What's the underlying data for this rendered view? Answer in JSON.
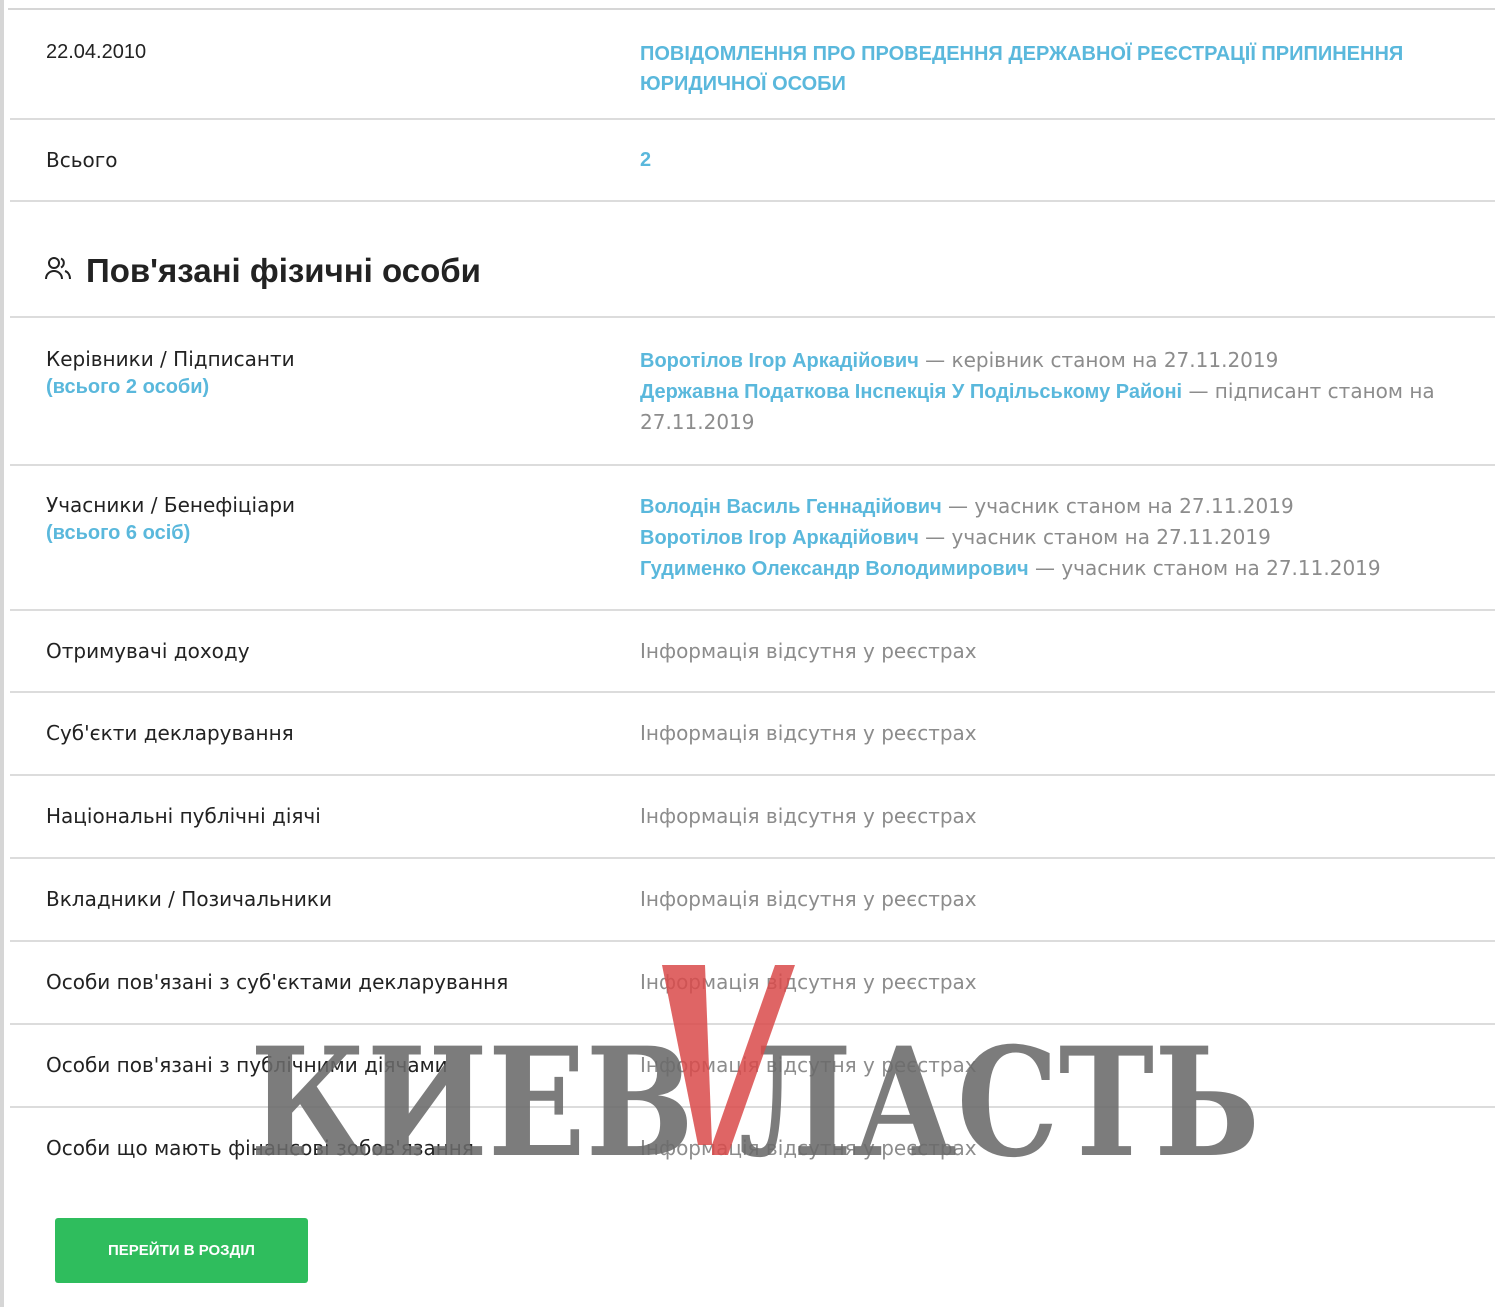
{
  "registrations": {
    "date": "22.04.2010",
    "notice": "ПОВІДОМЛЕННЯ ПРО ПРОВЕДЕННЯ ДЕРЖАВНОЇ РЕЄСТРАЦІЇ ПРИПИНЕННЯ ЮРИДИЧНОЇ ОСОБИ",
    "total_label": "Всього",
    "total_value": "2"
  },
  "section": {
    "icon": "people-icon",
    "title": "Пов'язані фізичні особи"
  },
  "managers": {
    "label": "Керівники / Підписанти",
    "count": "(всього 2 особи)",
    "items": [
      {
        "name": "Воротілов Ігор Аркадійович",
        "role": " — керівник станом на 27.11.2019"
      },
      {
        "name": "Державна Податкова Інспекція У Подільському Районі",
        "role": " — підписант станом на 27.11.2019"
      }
    ]
  },
  "participants": {
    "label": "Учасники / Бенефіціари",
    "count": "(всього 6 осіб)",
    "items": [
      {
        "name": "Володін Василь Геннадійович",
        "role": " — учасник станом на 27.11.2019"
      },
      {
        "name": "Воротілов Ігор Аркадійович",
        "role": " — учасник станом на 27.11.2019"
      },
      {
        "name": "Гудименко Олександр Володимирович",
        "role": " — учасник станом на 27.11.2019"
      }
    ]
  },
  "empty_rows": {
    "no_info": "Інформація відсутня у реєстрах",
    "income_recipients": "Отримувачі доходу",
    "declaration_subjects": "Суб'єкти декларування",
    "public_figures": "Національні публічні діячі",
    "depositors": "Вкладники / Позичальники",
    "related_to_declarants": "Особи пов'язані з суб'єктами декларування",
    "related_to_public_figures": "Особи пов'язані з публічними діячами",
    "financial_obligations": "Особи що мають фінансові зобов'язання"
  },
  "button": {
    "label": "ПЕРЕЙТИ В РОЗДІЛ"
  },
  "watermark": {
    "text": "КИЕВВЛАСТЬ",
    "color_main": "#6a6a6a",
    "color_accent": "#d94a4a"
  }
}
